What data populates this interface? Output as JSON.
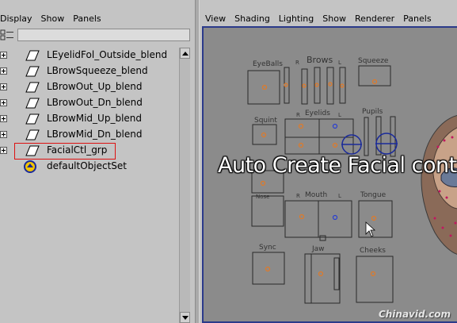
{
  "outliner": {
    "menu": [
      "Display",
      "Show",
      "Panels"
    ],
    "items": [
      {
        "label": "LEyelidFol_Outside_blend",
        "type": "blend"
      },
      {
        "label": "LBrowSqueeze_blend",
        "type": "blend"
      },
      {
        "label": "LBrowOut_Up_blend",
        "type": "blend"
      },
      {
        "label": "LBrowOut_Dn_blend",
        "type": "blend"
      },
      {
        "label": "LBrowMid_Up_blend",
        "type": "blend"
      },
      {
        "label": "LBrowMid_Dn_blend",
        "type": "blend"
      },
      {
        "label": "FacialCtl_grp",
        "type": "group",
        "highlighted": true
      },
      {
        "label": "defaultObjectSet",
        "type": "set"
      }
    ],
    "highlight_color": "#dd1111"
  },
  "panel": {
    "menu": [
      "View",
      "Shading",
      "Lighting",
      "Show",
      "Renderer",
      "Panels"
    ]
  },
  "viewport": {
    "overlay_text": "Auto Create Facial control",
    "watermark": "Chinavid.com",
    "labels": {
      "eyeballs": "EyeBalls",
      "brows": "Brows",
      "squeeze": "Squeeze",
      "r1": "R",
      "l1": "L",
      "eyelids": "Eyelids",
      "r2": "R",
      "l2": "L",
      "pupils": "Pupils",
      "squint": "Squint",
      "nose": "Nose",
      "mouth": "Mouth",
      "r3": "R",
      "l3": "L",
      "tongue": "Tongue",
      "sync": "Sync",
      "jaw": "Jaw",
      "cheeks": "Cheeks"
    },
    "colors": {
      "background": "#8b8b8b",
      "frame": "#2b3a8a",
      "dot_orange": "#e07a28",
      "dot_blue": "#2a3fd0"
    }
  }
}
